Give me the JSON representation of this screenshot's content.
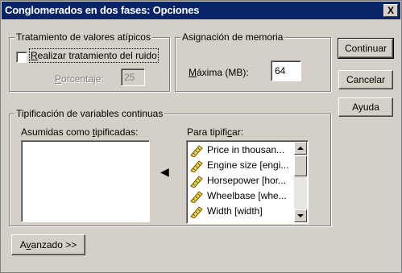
{
  "window": {
    "title": "Conglomerados en dos fases: Opciones",
    "close_label": "X"
  },
  "outliers": {
    "legend": "Tratamiento de valores atípicos",
    "checkbox_label_pre": "",
    "checkbox_label_u": "R",
    "checkbox_label_post": "ealizar tratamiento del ruido",
    "checkbox_checked": false,
    "percent_label_pre": "",
    "percent_label_u": "P",
    "percent_label_post": "orcentaje:",
    "percent_value": "25"
  },
  "memory": {
    "legend": "Asignación de memoria",
    "max_label_pre": "",
    "max_label_u": "M",
    "max_label_post": "áxima (MB):",
    "max_value": "64"
  },
  "buttons": {
    "continue": "Continuar",
    "cancel": "Cancelar",
    "help": "Ayuda",
    "advanced_pre": "A",
    "advanced_u": "v",
    "advanced_post": "anzado >>"
  },
  "standardize": {
    "legend": "Tipificación de variables continuas",
    "assumed_label_pre": "Asumidas como ",
    "assumed_label_u": "t",
    "assumed_label_post": "ipificadas:",
    "to_label_pre": "Para tipifi",
    "to_label_u": "c",
    "to_label_post": "ar:",
    "move_arrow": "◀",
    "variables": [
      {
        "label": "Price in thousan...",
        "icon": "scale-ruler-icon"
      },
      {
        "label": "Engine size [engi...",
        "icon": "scale-ruler-icon"
      },
      {
        "label": "Horsepower [hor...",
        "icon": "scale-ruler-icon"
      },
      {
        "label": "Wheelbase [whe...",
        "icon": "scale-ruler-icon"
      },
      {
        "label": "Width [width]",
        "icon": "scale-ruler-icon"
      }
    ]
  }
}
